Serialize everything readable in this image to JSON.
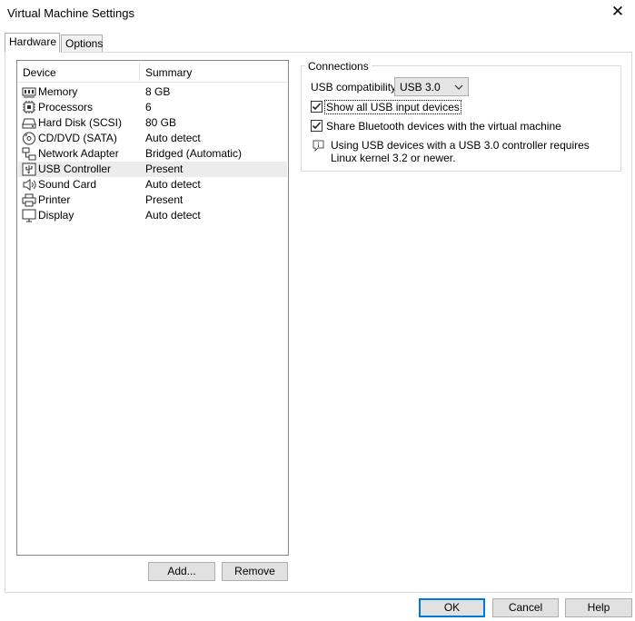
{
  "window": {
    "title": "Virtual Machine Settings",
    "close_glyph": "✕"
  },
  "tabs": [
    {
      "label": "Hardware",
      "active": true
    },
    {
      "label": "Options",
      "active": false
    }
  ],
  "device_list": {
    "columns": {
      "device": "Device",
      "summary": "Summary"
    },
    "rows": [
      {
        "icon": "memory-icon",
        "device": "Memory",
        "summary": "8 GB"
      },
      {
        "icon": "processor-icon",
        "device": "Processors",
        "summary": "6"
      },
      {
        "icon": "hard-disk-icon",
        "device": "Hard Disk (SCSI)",
        "summary": "80 GB"
      },
      {
        "icon": "cd-dvd-icon",
        "device": "CD/DVD (SATA)",
        "summary": "Auto detect"
      },
      {
        "icon": "network-adapter-icon",
        "device": "Network Adapter",
        "summary": "Bridged (Automatic)"
      },
      {
        "icon": "usb-icon",
        "device": "USB Controller",
        "summary": "Present",
        "selected": true
      },
      {
        "icon": "speaker-icon",
        "device": "Sound Card",
        "summary": "Auto detect"
      },
      {
        "icon": "printer-icon",
        "device": "Printer",
        "summary": "Present"
      },
      {
        "icon": "monitor-icon",
        "device": "Display",
        "summary": "Auto detect"
      }
    ]
  },
  "list_buttons": {
    "add": "Add...",
    "remove": "Remove"
  },
  "connections": {
    "title": "Connections",
    "usb_compat_label": "USB compatibility:",
    "usb_compat_value": "USB 3.0",
    "show_all_usb": {
      "label": "Show all USB input devices",
      "checked": true
    },
    "share_bluetooth": {
      "label": "Share Bluetooth devices with the virtual machine",
      "checked": true
    },
    "info_text": "Using USB devices with a USB 3.0 controller requires Linux kernel 3.2 or newer."
  },
  "footer": {
    "ok": "OK",
    "cancel": "Cancel",
    "help": "Help"
  },
  "colors": {
    "selection": "#ececec",
    "accent": "#0078d7",
    "button_bg": "#e1e1e1"
  }
}
